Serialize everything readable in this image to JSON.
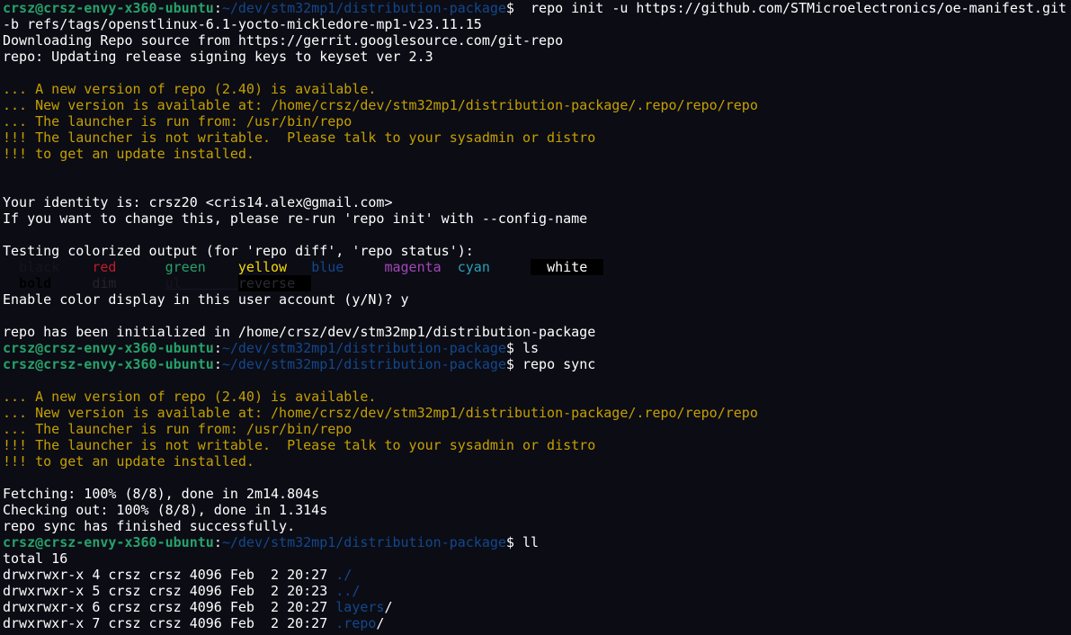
{
  "terminal": {
    "lines": [
      [
        {
          "t": "crsz@crsz-envy-x360-ubuntu",
          "c": "user"
        },
        {
          "t": ":",
          "c": "plain"
        },
        {
          "t": "~/dev/stm32mp1/distribution-package",
          "c": "path"
        },
        {
          "t": "$  repo init -u https://github.com/STMicroelectronics/oe-manifest.git",
          "c": "plain"
        }
      ],
      [
        {
          "t": "-b refs/tags/openstlinux-6.1-yocto-mickledore-mp1-v23.11.15",
          "c": "plain"
        }
      ],
      [
        {
          "t": "Downloading Repo source from https://gerrit.googlesource.com/git-repo",
          "c": "plain"
        }
      ],
      [
        {
          "t": "repo: Updating release signing keys to keyset ver 2.3",
          "c": "plain"
        }
      ],
      [],
      [
        {
          "t": "... A new version of repo (2.40) is available.",
          "c": "warn"
        }
      ],
      [
        {
          "t": "... New version is available at: /home/crsz/dev/stm32mp1/distribution-package/.repo/repo/repo",
          "c": "warn"
        }
      ],
      [
        {
          "t": "... The launcher is run from: /usr/bin/repo",
          "c": "warn"
        }
      ],
      [
        {
          "t": "!!! The launcher is not writable.  Please talk to your sysadmin or distro",
          "c": "warn"
        }
      ],
      [
        {
          "t": "!!! to get an update installed.",
          "c": "warn"
        }
      ],
      [],
      [],
      [
        {
          "t": "Your identity is: crsz20 <cris14.alex@gmail.com>",
          "c": "plain"
        }
      ],
      [
        {
          "t": "If you want to change this, please re-run 'repo init' with --config-name",
          "c": "plain"
        }
      ],
      [],
      [
        {
          "t": "Testing colorized output (for 'repo diff', 'repo status'):",
          "c": "plain"
        }
      ],
      [
        {
          "t": "  black    ",
          "c": "black"
        },
        {
          "t": "red      ",
          "c": "red"
        },
        {
          "t": "green    ",
          "c": "green"
        },
        {
          "t": "yellow   ",
          "c": "yellow"
        },
        {
          "t": "blue     ",
          "c": "blue"
        },
        {
          "t": "magenta  ",
          "c": "magenta"
        },
        {
          "t": "cyan     ",
          "c": "cyan"
        },
        {
          "t": "  white  ",
          "c": "white-hl"
        }
      ],
      [
        {
          "t": "  bold     ",
          "c": "bold"
        },
        {
          "t": "dim      ",
          "c": "dim"
        },
        {
          "t": "ul       ",
          "c": "ul"
        },
        {
          "t": "reverse  ",
          "c": "reverse"
        }
      ],
      [
        {
          "t": "Enable color display in this user account (y/N)? y",
          "c": "plain"
        }
      ],
      [],
      [
        {
          "t": "repo has been initialized in /home/crsz/dev/stm32mp1/distribution-package",
          "c": "plain"
        }
      ],
      [
        {
          "t": "crsz@crsz-envy-x360-ubuntu",
          "c": "user"
        },
        {
          "t": ":",
          "c": "plain"
        },
        {
          "t": "~/dev/stm32mp1/distribution-package",
          "c": "path"
        },
        {
          "t": "$ ls",
          "c": "plain"
        }
      ],
      [
        {
          "t": "crsz@crsz-envy-x360-ubuntu",
          "c": "user"
        },
        {
          "t": ":",
          "c": "plain"
        },
        {
          "t": "~/dev/stm32mp1/distribution-package",
          "c": "path"
        },
        {
          "t": "$ repo sync",
          "c": "plain"
        }
      ],
      [],
      [
        {
          "t": "... A new version of repo (2.40) is available.",
          "c": "warn"
        }
      ],
      [
        {
          "t": "... New version is available at: /home/crsz/dev/stm32mp1/distribution-package/.repo/repo/repo",
          "c": "warn"
        }
      ],
      [
        {
          "t": "... The launcher is run from: /usr/bin/repo",
          "c": "warn"
        }
      ],
      [
        {
          "t": "!!! The launcher is not writable.  Please talk to your sysadmin or distro",
          "c": "warn"
        }
      ],
      [
        {
          "t": "!!! to get an update installed.",
          "c": "warn"
        }
      ],
      [],
      [
        {
          "t": "Fetching: 100% (8/8), done in 2m14.804s",
          "c": "plain"
        }
      ],
      [
        {
          "t": "Checking out: 100% (8/8), done in 1.314s",
          "c": "plain"
        }
      ],
      [
        {
          "t": "repo sync has finished successfully.",
          "c": "plain"
        }
      ],
      [
        {
          "t": "crsz@crsz-envy-x360-ubuntu",
          "c": "user"
        },
        {
          "t": ":",
          "c": "plain"
        },
        {
          "t": "~/dev/stm32mp1/distribution-package",
          "c": "path"
        },
        {
          "t": "$ ll",
          "c": "plain"
        }
      ],
      [
        {
          "t": "total 16",
          "c": "plain"
        }
      ],
      [
        {
          "t": "drwxrwxr-x 4 crsz crsz 4096 Feb  2 20:27 ",
          "c": "plain"
        },
        {
          "t": "./",
          "c": "dir"
        }
      ],
      [
        {
          "t": "drwxrwxr-x 5 crsz crsz 4096 Feb  2 20:23 ",
          "c": "plain"
        },
        {
          "t": "../",
          "c": "dir"
        }
      ],
      [
        {
          "t": "drwxrwxr-x 6 crsz crsz 4096 Feb  2 20:27 ",
          "c": "plain"
        },
        {
          "t": "layers",
          "c": "dir"
        },
        {
          "t": "/",
          "c": "plain"
        }
      ],
      [
        {
          "t": "drwxrwxr-x 7 crsz crsz 4096 Feb  2 20:27 ",
          "c": "plain"
        },
        {
          "t": ".repo",
          "c": "dir"
        },
        {
          "t": "/",
          "c": "plain"
        }
      ]
    ]
  }
}
